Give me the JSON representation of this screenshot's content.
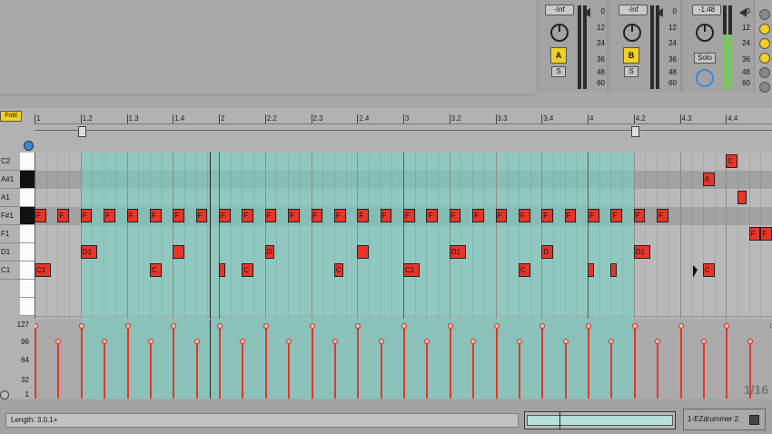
{
  "mixer": {
    "channels": [
      {
        "volume": "-Inf",
        "track_label": "A",
        "solo_label": "S",
        "meter_level": 0
      },
      {
        "volume": "-Inf",
        "track_label": "B",
        "solo_label": "S",
        "meter_level": 0
      },
      {
        "volume": "-1.48",
        "solo_label": "Solo",
        "meter_level": 0.65
      }
    ],
    "scale": [
      "0",
      "12",
      "24",
      "36",
      "48",
      "60"
    ]
  },
  "clip": {
    "fold_label": "Fold",
    "ruler_labels": [
      "1",
      "1.2",
      "1.3",
      "1.4",
      "2",
      "2.2",
      "2.3",
      "2.4",
      "3",
      "3.2",
      "3.3",
      "3.4",
      "4",
      "4.2",
      "4.3",
      "4.4"
    ],
    "keys": [
      "C2",
      "A#1",
      "A1",
      "F#1",
      "F1",
      "D1",
      "C1"
    ],
    "notes": [
      {
        "pitch": 3,
        "start": 1.0,
        "len": 0.0625,
        "label": "F"
      },
      {
        "pitch": 3,
        "start": 1.125,
        "len": 0.0625,
        "label": "F"
      },
      {
        "pitch": 3,
        "start": 1.25,
        "len": 0.0625,
        "label": "F"
      },
      {
        "pitch": 3,
        "start": 1.375,
        "len": 0.0625,
        "label": "F"
      },
      {
        "pitch": 3,
        "start": 1.5,
        "len": 0.0625,
        "label": "F"
      },
      {
        "pitch": 3,
        "start": 1.625,
        "len": 0.0625,
        "label": "F"
      },
      {
        "pitch": 3,
        "start": 1.75,
        "len": 0.0625,
        "label": "F"
      },
      {
        "pitch": 3,
        "start": 1.875,
        "len": 0.0625,
        "label": "F"
      },
      {
        "pitch": 3,
        "start": 2.0,
        "len": 0.0625,
        "label": "F"
      },
      {
        "pitch": 3,
        "start": 2.125,
        "len": 0.0625,
        "label": "F"
      },
      {
        "pitch": 3,
        "start": 2.25,
        "len": 0.0625,
        "label": "F"
      },
      {
        "pitch": 3,
        "start": 2.375,
        "len": 0.0625,
        "label": "F"
      },
      {
        "pitch": 3,
        "start": 2.5,
        "len": 0.0625,
        "label": "F"
      },
      {
        "pitch": 3,
        "start": 2.625,
        "len": 0.0625,
        "label": "F"
      },
      {
        "pitch": 3,
        "start": 2.75,
        "len": 0.0625,
        "label": "F"
      },
      {
        "pitch": 3,
        "start": 2.875,
        "len": 0.0625,
        "label": "F"
      },
      {
        "pitch": 3,
        "start": 3.0,
        "len": 0.0625,
        "label": "F"
      },
      {
        "pitch": 3,
        "start": 3.125,
        "len": 0.0625,
        "label": "F"
      },
      {
        "pitch": 3,
        "start": 3.25,
        "len": 0.0625,
        "label": "F"
      },
      {
        "pitch": 3,
        "start": 3.375,
        "len": 0.0625,
        "label": "F"
      },
      {
        "pitch": 3,
        "start": 3.5,
        "len": 0.0625,
        "label": "F"
      },
      {
        "pitch": 3,
        "start": 3.625,
        "len": 0.0625,
        "label": "F"
      },
      {
        "pitch": 3,
        "start": 3.75,
        "len": 0.0625,
        "label": "F"
      },
      {
        "pitch": 3,
        "start": 3.875,
        "len": 0.0625,
        "label": "F"
      },
      {
        "pitch": 3,
        "start": 4.0,
        "len": 0.0625,
        "label": "F"
      },
      {
        "pitch": 3,
        "start": 4.125,
        "len": 0.0625,
        "label": "F"
      },
      {
        "pitch": 3,
        "start": 4.25,
        "len": 0.0625,
        "label": "F"
      },
      {
        "pitch": 3,
        "start": 4.375,
        "len": 0.0625,
        "label": "F"
      },
      {
        "pitch": 6,
        "start": 1.0,
        "len": 0.0875,
        "label": "C1"
      },
      {
        "pitch": 6,
        "start": 1.625,
        "len": 0.0625,
        "label": "C"
      },
      {
        "pitch": 6,
        "start": 2.0,
        "len": 0.035,
        "label": ""
      },
      {
        "pitch": 6,
        "start": 2.125,
        "len": 0.0625,
        "label": "C"
      },
      {
        "pitch": 6,
        "start": 2.625,
        "len": 0.05,
        "label": "C"
      },
      {
        "pitch": 6,
        "start": 3.0,
        "len": 0.0875,
        "label": "C1"
      },
      {
        "pitch": 6,
        "start": 3.625,
        "len": 0.0625,
        "label": "C"
      },
      {
        "pitch": 6,
        "start": 4.0,
        "len": 0.03,
        "label": ""
      },
      {
        "pitch": 6,
        "start": 4.125,
        "len": 0.035,
        "label": ""
      },
      {
        "pitch": 6,
        "start": 4.625,
        "len": 0.0625,
        "label": "C"
      },
      {
        "pitch": 5,
        "start": 1.25,
        "len": 0.0875,
        "label": "D1"
      },
      {
        "pitch": 5,
        "start": 1.75,
        "len": 0.0625,
        "label": ""
      },
      {
        "pitch": 5,
        "start": 2.25,
        "len": 0.05,
        "label": "D"
      },
      {
        "pitch": 5,
        "start": 2.75,
        "len": 0.0625,
        "label": ""
      },
      {
        "pitch": 5,
        "start": 3.25,
        "len": 0.0875,
        "label": "D1"
      },
      {
        "pitch": 5,
        "start": 3.75,
        "len": 0.0625,
        "label": "D"
      },
      {
        "pitch": 5,
        "start": 4.25,
        "len": 0.0875,
        "label": "D1"
      },
      {
        "pitch": 0,
        "start": 4.75,
        "len": 0.0625,
        "label": "C"
      },
      {
        "pitch": 1,
        "start": 4.625,
        "len": 0.0625,
        "label": "A"
      },
      {
        "pitch": 2,
        "start": 4.8125,
        "len": 0.05,
        "label": ""
      },
      {
        "pitch": 4,
        "start": 4.875,
        "len": 0.0625,
        "label": "F"
      },
      {
        "pitch": 4,
        "start": 4.9375,
        "len": 0.0625,
        "label": "F"
      }
    ],
    "velocities": [
      127,
      100,
      127,
      100,
      127,
      100,
      127,
      100,
      127,
      100,
      127,
      100,
      127,
      100,
      127,
      100,
      127,
      100,
      127,
      100,
      127,
      100,
      127,
      100,
      127,
      100,
      127,
      100,
      127,
      100,
      127,
      100,
      127,
      127,
      127,
      127,
      127
    ],
    "velocity_scale": [
      "127",
      "96",
      "64",
      "32",
      "1"
    ],
    "grid_label": "1/16",
    "length_label": "Length: 3.0.1+",
    "device_label": "1-EZdrummer 2"
  }
}
